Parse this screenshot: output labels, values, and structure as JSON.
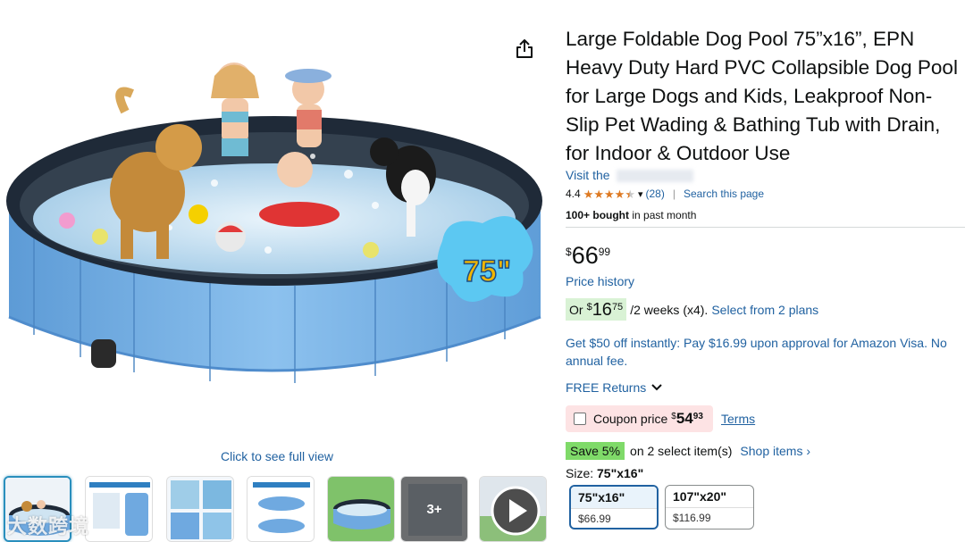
{
  "gallery": {
    "full_view_label": "Click to see full view",
    "badge_text": "75\"",
    "more_label": "3+",
    "watermark": "大数跨境"
  },
  "product": {
    "title": "Large Foldable Dog Pool 75”x16”, EPN Heavy Duty Hard PVC Collapsible Dog Pool for Large Dogs and Kids, Leakproof Non-Slip Pet Wading & Bathing Tub with Drain, for Indoor & Outdoor Use",
    "store_prefix": "Visit the",
    "rating": "4.4",
    "rating_stars": 4.4,
    "review_count": "(28)",
    "search_page": "Search this page",
    "bought_bold": "100+ bought",
    "bought_rest": "in past month"
  },
  "price": {
    "symbol": "$",
    "whole": "66",
    "fraction": "99",
    "history_label": "Price history"
  },
  "installment": {
    "or": "Or",
    "symbol": "$",
    "whole": "16",
    "fraction": "75",
    "rest": "/2 weeks (x4).",
    "plans_link": "Select from 2 plans"
  },
  "offers": {
    "visa": "Get $50 off instantly: Pay $16.99 upon approval for Amazon Visa. No annual fee.",
    "free_returns": "FREE Returns"
  },
  "coupon": {
    "label": "Coupon price",
    "symbol": "$",
    "whole": "54",
    "fraction": "93",
    "terms": "Terms"
  },
  "save": {
    "badge": "Save 5%",
    "rest": "on 2 select item(s)",
    "shop_items": "Shop items ›"
  },
  "size": {
    "label": "Size:",
    "selected": "75\"x16\"",
    "options": [
      {
        "name": "75\"x16\"",
        "price": "$66.99"
      },
      {
        "name": "107\"x20\"",
        "price": "$116.99"
      }
    ]
  },
  "colors": {
    "link": "#2162a1",
    "pool_blue": "#79b6ea",
    "star": "#de7921",
    "save_green": "#7fda69",
    "coupon_bg": "#fde3e4"
  }
}
